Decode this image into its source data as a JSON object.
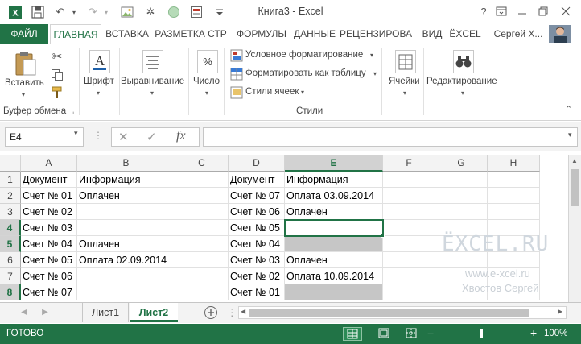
{
  "window": {
    "title": "Книга3 - Excel",
    "help": "?",
    "user": "Сергей Х..."
  },
  "tabs": [
    "ФАЙЛ",
    "ГЛАВНАЯ",
    "ВСТАВКА",
    "РАЗМЕТКА СТР",
    "ФОРМУЛЫ",
    "ДАННЫЕ",
    "РЕЦЕНЗИРОВА",
    "ВИД",
    "ЁXCEL"
  ],
  "ribbon": {
    "paste": "Вставить",
    "clipboard_group": "Буфер обмена",
    "font": "Шрифт",
    "alignment": "Выравнивание",
    "number": "Число",
    "conditional_formatting": "Условное форматирование",
    "format_as_table": "Форматировать как таблицу",
    "cell_styles": "Стили ячеек",
    "styles_group": "Стили",
    "cells": "Ячейки",
    "editing": "Редактирование"
  },
  "formula_bar": {
    "name_box": "E4",
    "fx": "fx",
    "formula": ""
  },
  "columns": [
    "A",
    "B",
    "C",
    "D",
    "E",
    "F",
    "G",
    "H"
  ],
  "selected_column": "E",
  "rows": [
    "1",
    "2",
    "3",
    "4",
    "5",
    "6",
    "7",
    "8"
  ],
  "selected_rows": [
    "4",
    "5",
    "8"
  ],
  "cells": {
    "A1": "Документ",
    "B1": "Информация",
    "D1": "Документ",
    "E1": "Информация",
    "A2": "Счет № 01",
    "B2": "Оплачен",
    "D2": "Счет № 07",
    "E2": "Оплата 03.09.2014",
    "A3": "Счет № 02",
    "D3": "Счет № 06",
    "E3": "Оплачен",
    "A4": "Счет № 03",
    "D4": "Счет № 05",
    "A5": "Счет № 04",
    "B5": "Оплачен",
    "D5": "Счет № 04",
    "A6": "Счет № 05",
    "B6": "Оплата 02.09.2014",
    "D6": "Счет № 03",
    "E6": "Оплачен",
    "A7": "Счет № 06",
    "D7": "Счет № 02",
    "E7": "Оплата 10.09.2014",
    "A8": "Счет № 07",
    "D8": "Счет № 01"
  },
  "sheets": [
    "Лист1",
    "Лист2"
  ],
  "active_sheet": "Лист2",
  "status": {
    "ready": "ГОТОВО",
    "zoom": "100%"
  },
  "watermark": {
    "logo": "ЁXCEL.RU",
    "url": "www.e-xcel.ru",
    "author": "Хвостов Сергей"
  },
  "colors": {
    "excel_green": "#217346",
    "gray_cell": "#c6c6c6"
  }
}
